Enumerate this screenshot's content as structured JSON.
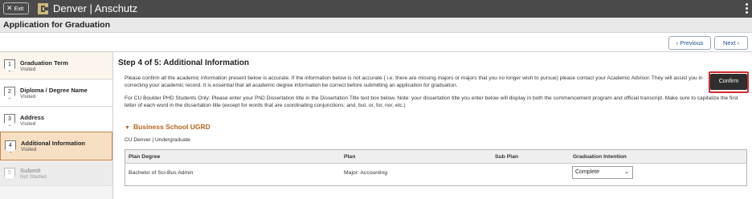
{
  "topbar": {
    "exit_label": "Exit",
    "brand": "Denver | Anschutz"
  },
  "page": {
    "title": "Application for Graduation"
  },
  "nav": {
    "previous": "Previous",
    "next": "Next"
  },
  "steps": [
    {
      "number": "1",
      "label": "Graduation Term",
      "status": "Visited"
    },
    {
      "number": "2",
      "label": "Diploma / Degree Name",
      "status": "Visited"
    },
    {
      "number": "3",
      "label": "Address",
      "status": "Visited"
    },
    {
      "number": "4",
      "label": "Additional Information",
      "status": "Visited"
    },
    {
      "number": "5",
      "label": "Submit",
      "status": "Not Started"
    }
  ],
  "main": {
    "heading": "Step 4 of 5: Additional Information",
    "para1": "Please confirm all the academic information present below is accurate. If the information below is not accurate ( i.e. there are missing majors or majors that you no longer wish to pursue) please contact your Academic Advisor. They will assist you in correcting your academic record. It is essential that all academic degree information be correct before submitting an application for graduation.",
    "para2": "For CU Boulder PHD Students Only: Please enter your PhD Dissertation title in the Dissertation Title text box below. Note: your dissertation title you enter below will display in both the commencement program and official transcript. Make sure to capitalize the first letter of each word in the dissertation title (except for words that are coordinating conjunctions: and, but, or, for, nor, etc.)",
    "confirm": "Confirm",
    "section_title": "Business School UGRD",
    "campus": "CU Denver | Undergraduate"
  },
  "table": {
    "headers": {
      "plan_degree": "Plan Degree",
      "plan": "Plan",
      "sub_plan": "Sub Plan",
      "grad_intention": "Graduation Intention"
    },
    "rows": [
      {
        "plan_degree": "Bachelor of Sci-Bus Admin",
        "plan": "Major: Accounting",
        "sub_plan": "",
        "grad_intention": "Complete"
      }
    ]
  },
  "colors": {
    "accent": "#b5651d",
    "active_step": "#f6dfc3",
    "highlight": "#d22a2a"
  }
}
